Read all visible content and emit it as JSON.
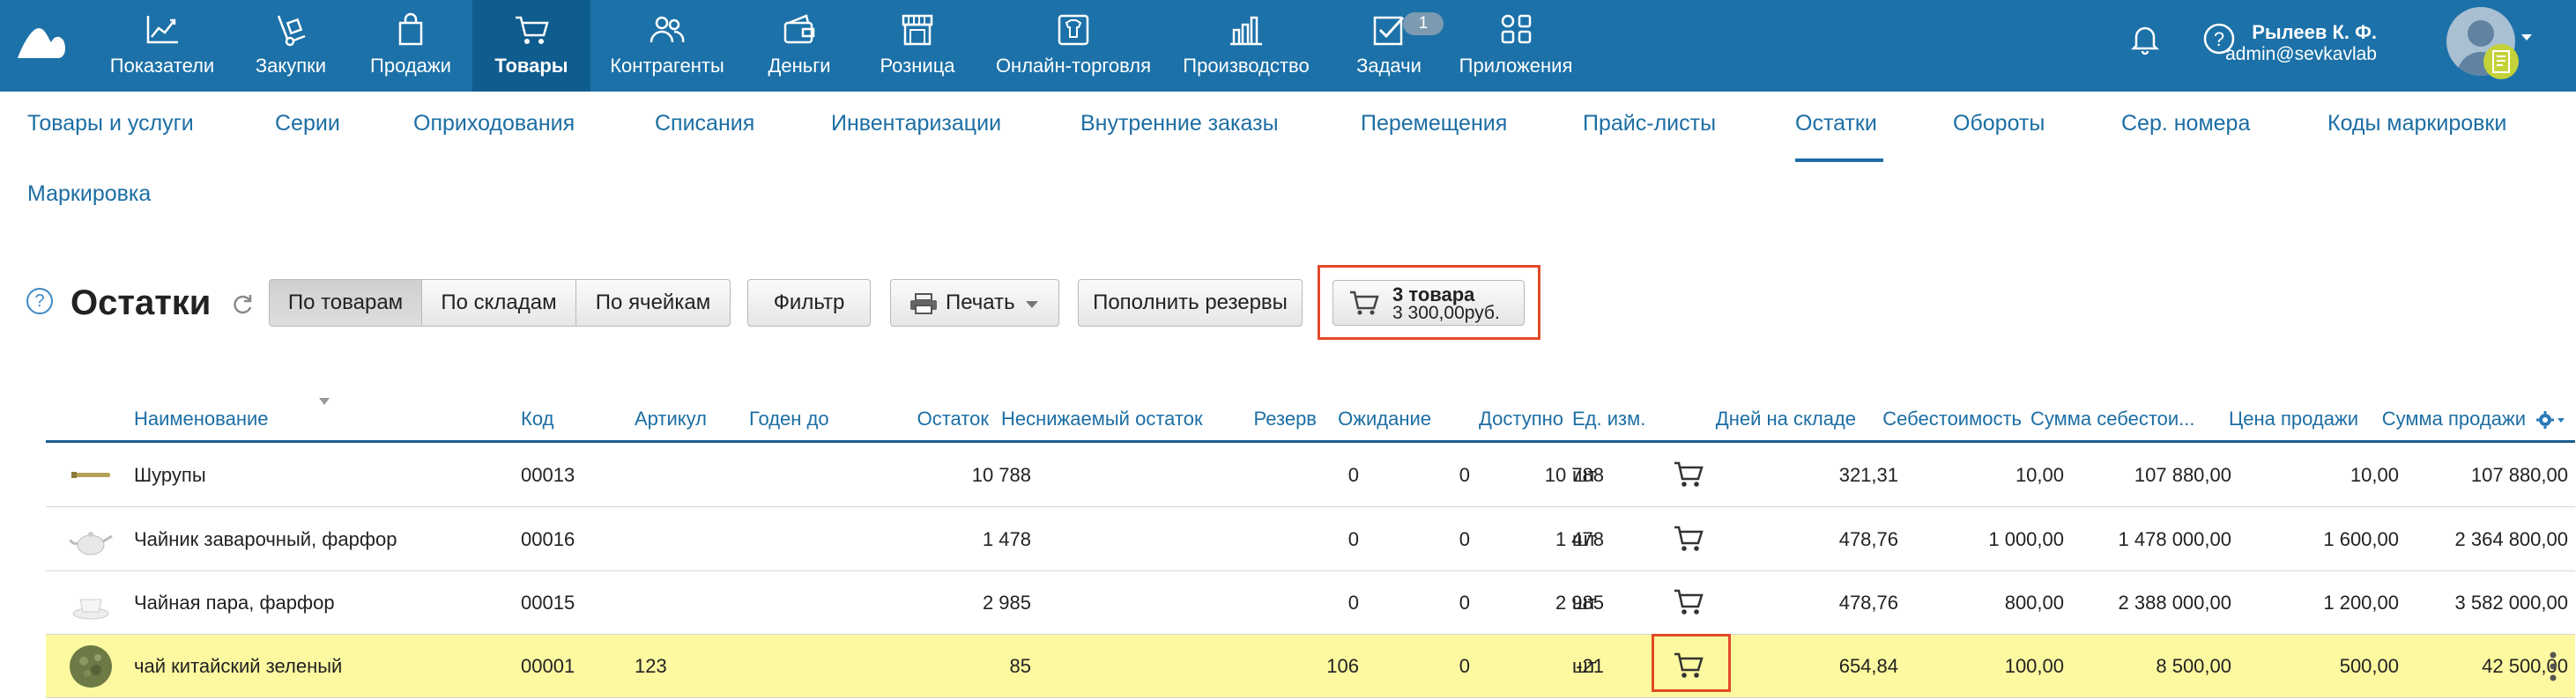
{
  "nav": {
    "items": [
      {
        "label": "Показатели",
        "icon": "chart-line-icon"
      },
      {
        "label": "Закупки",
        "icon": "hand-truck-icon"
      },
      {
        "label": "Продажи",
        "icon": "shopping-bag-icon"
      },
      {
        "label": "Товары",
        "icon": "cart-icon"
      },
      {
        "label": "Контрагенты",
        "icon": "people-icon"
      },
      {
        "label": "Деньги",
        "icon": "wallet-icon"
      },
      {
        "label": "Розница",
        "icon": "store-icon"
      },
      {
        "label": "Онлайн-торговля",
        "icon": "tshirt-tag-icon"
      },
      {
        "label": "Производство",
        "icon": "factory-icon"
      },
      {
        "label": "Задачи",
        "icon": "task-check-icon"
      },
      {
        "label": "Приложения",
        "icon": "apps-icon"
      }
    ],
    "active": "Товары",
    "tasks_badge": "1"
  },
  "user": {
    "name": "Рылеев К. Ф.",
    "email": "admin@sevkavlab"
  },
  "subnav": {
    "items": [
      "Товары и услуги",
      "Серии",
      "Оприходования",
      "Списания",
      "Инвентаризации",
      "Внутренние заказы",
      "Перемещения",
      "Прайс-листы",
      "Остатки",
      "Обороты",
      "Сер. номера",
      "Коды маркировки",
      "Маркировка"
    ],
    "active": "Остатки"
  },
  "toolbar": {
    "help": "?",
    "title": "Остатки",
    "view_buttons": [
      "По товарам",
      "По складам",
      "По ячейкам"
    ],
    "active_view": "По товарам",
    "filter_label": "Фильтр",
    "print_label": "Печать",
    "reserve_label": "Пополнить резервы",
    "cart_count": "3 товара",
    "cart_total": "3 300,00руб."
  },
  "table": {
    "columns": [
      "Наименование",
      "Код",
      "Артикул",
      "Годен до",
      "Остаток",
      "Неснижаемый остаток",
      "Резерв",
      "Ожидание",
      "Доступно",
      "Ед. изм.",
      "Дней на складе",
      "Себестоимость",
      "Сумма себестои...",
      "Цена продажи",
      "Сумма продажи"
    ],
    "rows": [
      {
        "name": "Шурупы",
        "code": "00013",
        "article": "",
        "expiry": "",
        "stock": "10 788",
        "min_stock": "",
        "reserve": "0",
        "waiting": "0",
        "available": "10 788",
        "unit": "шт",
        "days": "321,31",
        "cost": "10,00",
        "cost_sum": "107 880,00",
        "price": "10,00",
        "price_sum": "107 880,00",
        "thumb": "screw",
        "highlight": false
      },
      {
        "name": "Чайник заварочный, фарфор",
        "code": "00016",
        "article": "",
        "expiry": "",
        "stock": "1 478",
        "min_stock": "",
        "reserve": "0",
        "waiting": "0",
        "available": "1 478",
        "unit": "шт",
        "days": "478,76",
        "cost": "1 000,00",
        "cost_sum": "1 478 000,00",
        "price": "1 600,00",
        "price_sum": "2 364 800,00",
        "thumb": "teapot",
        "highlight": false
      },
      {
        "name": "Чайная пара, фарфор",
        "code": "00015",
        "article": "",
        "expiry": "",
        "stock": "2 985",
        "min_stock": "",
        "reserve": "0",
        "waiting": "0",
        "available": "2 985",
        "unit": "шт",
        "days": "478,76",
        "cost": "800,00",
        "cost_sum": "2 388 000,00",
        "price": "1 200,00",
        "price_sum": "3 582 000,00",
        "thumb": "cup",
        "highlight": false
      },
      {
        "name": "чай китайский зеленый",
        "code": "00001",
        "article": "123",
        "expiry": "",
        "stock": "85",
        "min_stock": "",
        "reserve": "106",
        "waiting": "0",
        "available": "-21",
        "unit": "шт",
        "days": "654,84",
        "cost": "100,00",
        "cost_sum": "8 500,00",
        "price": "500,00",
        "price_sum": "42 500,00",
        "thumb": "tea-leaves",
        "highlight": true
      }
    ]
  },
  "colors": {
    "topbar": "#1c71a8",
    "topbar_active": "#0f5c8e",
    "link": "#1c6ea4",
    "highlight_row": "#fdf9a0",
    "callout": "#e24a2a"
  }
}
